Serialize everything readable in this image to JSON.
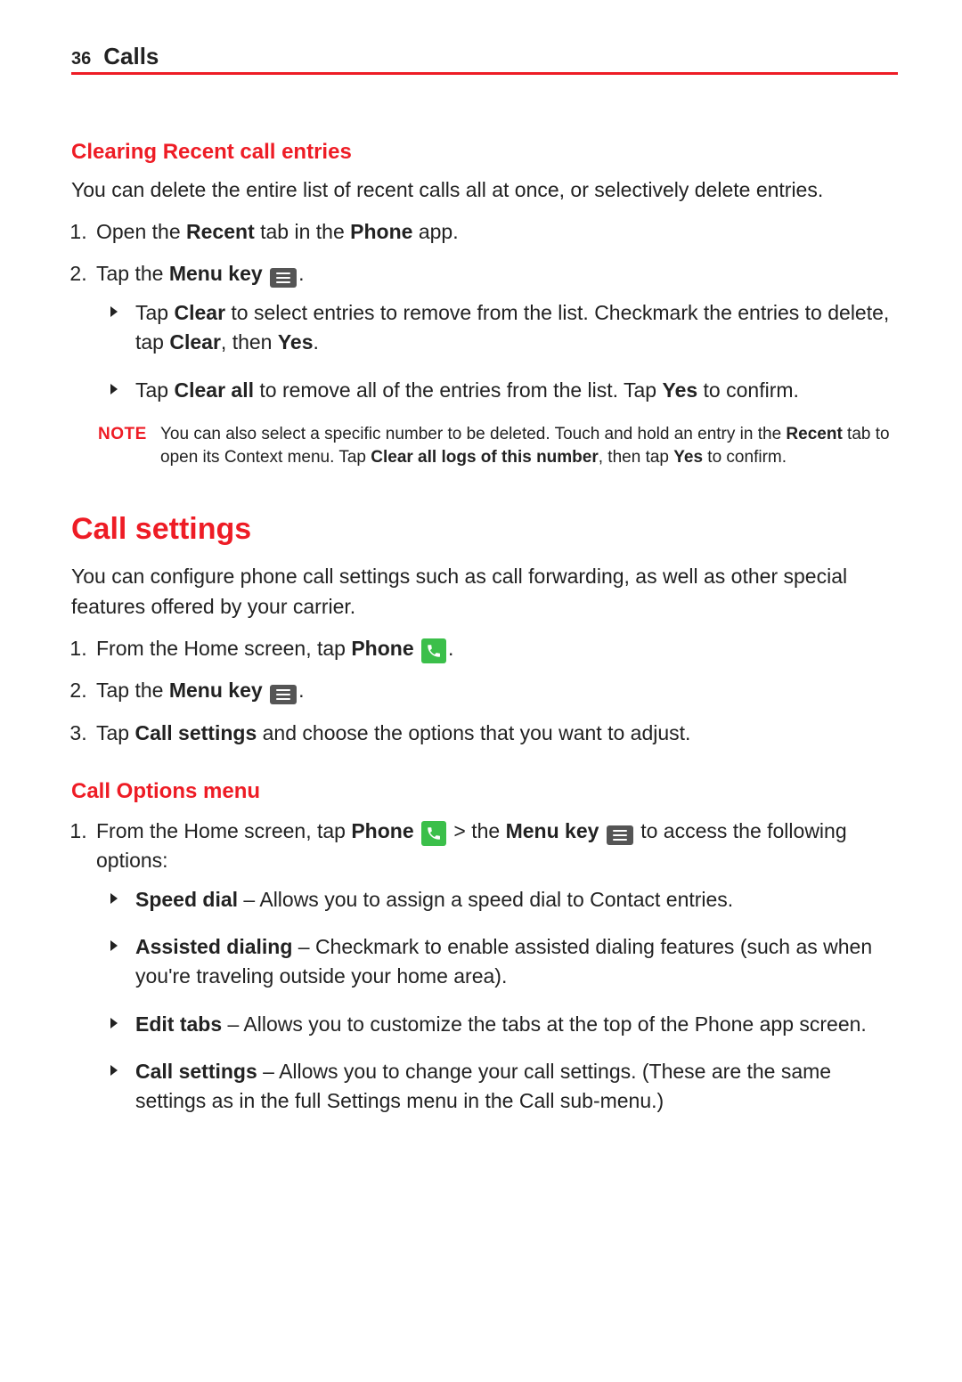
{
  "header": {
    "page_number": "36",
    "chapter": "Calls"
  },
  "section1": {
    "heading": "Clearing Recent call entries",
    "intro": "You can delete the entire list of recent calls all at once, or selectively delete entries.",
    "step1_pre": "Open the ",
    "step1_b1": "Recent",
    "step1_mid": " tab in the ",
    "step1_b2": "Phone",
    "step1_post": " app.",
    "step2_pre": "Tap the ",
    "step2_b": "Menu key",
    "bullet1_pre": "Tap ",
    "bullet1_b1": "Clear",
    "bullet1_mid": " to select entries to remove from the list. Checkmark the entries to delete, tap ",
    "bullet1_b2": "Clear",
    "bullet1_mid2": ", then ",
    "bullet1_b3": "Yes",
    "bullet1_post": ".",
    "bullet2_pre": "Tap ",
    "bullet2_b1": "Clear all",
    "bullet2_mid": " to remove all of the entries from the list. Tap ",
    "bullet2_b2": "Yes",
    "bullet2_post": " to confirm.",
    "note_label": "NOTE",
    "note_pre": "You can also select a specific number to be deleted. Touch and hold an entry in the ",
    "note_b1": "Recent",
    "note_mid1": " tab to open its Context menu. Tap ",
    "note_b2": "Clear all logs of this number",
    "note_mid2": ", then tap ",
    "note_b3": "Yes",
    "note_post": " to confirm."
  },
  "section2": {
    "heading": "Call settings",
    "intro": "You can configure phone call settings such as call forwarding, as well as other special features offered by your carrier.",
    "step1_pre": "From the Home screen, tap ",
    "step1_b": "Phone",
    "step2_pre": "Tap the ",
    "step2_b": "Menu key",
    "step3_pre": "Tap ",
    "step3_b": "Call settings",
    "step3_post": " and choose the options that you want to adjust."
  },
  "section3": {
    "heading": "Call Options menu",
    "step1_pre": "From the Home screen, tap ",
    "step1_b1": "Phone",
    "step1_gt": " > ",
    "step1_mid": "the ",
    "step1_b2": "Menu key",
    "step1_post": " to access the following options:",
    "opt1_b": "Speed dial",
    "opt1_txt": " – Allows you to assign a speed dial to Contact entries.",
    "opt2_b": "Assisted dialing",
    "opt2_txt": " – Checkmark to enable assisted dialing features (such as when you're traveling outside your home area).",
    "opt3_b": "Edit tabs",
    "opt3_txt": " – Allows you to customize the tabs at the top of the Phone app screen.",
    "opt4_b": "Call settings",
    "opt4_txt": " – Allows you to change your call settings. (These are the same settings as in the full Settings menu in the Call sub-menu.)"
  }
}
